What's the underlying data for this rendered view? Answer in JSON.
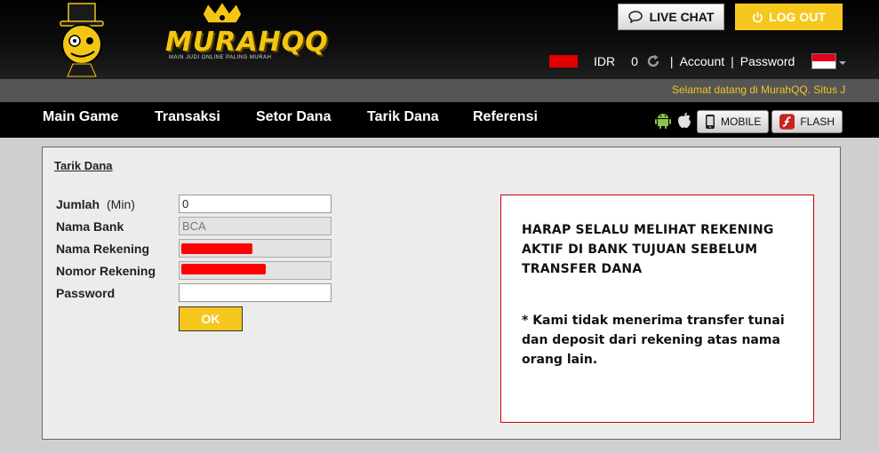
{
  "header": {
    "logo_text": "MURAHQQ",
    "logo_tagline": "MAIN JUDI ONLINE PALING MURAH",
    "live_chat_label": "LIVE CHAT",
    "logout_label": "LOG OUT",
    "currency": "IDR",
    "balance": "0",
    "account_label": "Account",
    "password_label": "Password",
    "separator": "|",
    "flag_colors": {
      "top": "#e2001a",
      "bottom": "#ffffff"
    },
    "icons": [
      "chat-bubble-icon",
      "power-icon",
      "refresh-icon",
      "indonesia-flag-icon"
    ]
  },
  "marquee": {
    "text": "Selamat datang di MurahQQ. Situs J"
  },
  "nav": {
    "items": [
      "Main Game",
      "Transaksi",
      "Setor Dana",
      "Tarik Dana",
      "Referensi"
    ],
    "mobile_label": "MOBILE",
    "flash_label": "FLASH",
    "icons": [
      "android-icon",
      "apple-icon",
      "phone-icon",
      "flash-icon"
    ]
  },
  "form": {
    "title": "Tarik Dana",
    "fields": [
      {
        "label": "Jumlah",
        "hint": "(Min)",
        "value": "0"
      },
      {
        "label": "Nama Bank",
        "value": "BCA"
      },
      {
        "label": "Nama Rekening",
        "value": ""
      },
      {
        "label": "Nomor Rekening",
        "value": ""
      },
      {
        "label": "Password",
        "value": ""
      }
    ],
    "submit_label": "OK"
  },
  "notice": {
    "warning": "HARAP SELALU MELIHAT REKENING AKTIF DI BANK TUJUAN SEBELUM TRANSFER DANA",
    "note": "* Kami tidak menerima transfer tunai dan deposit dari rekening atas nama orang lain."
  },
  "colors": {
    "accent": "#f6c81f",
    "redaction": "#ff0000",
    "notice_border": "#cc0000"
  }
}
